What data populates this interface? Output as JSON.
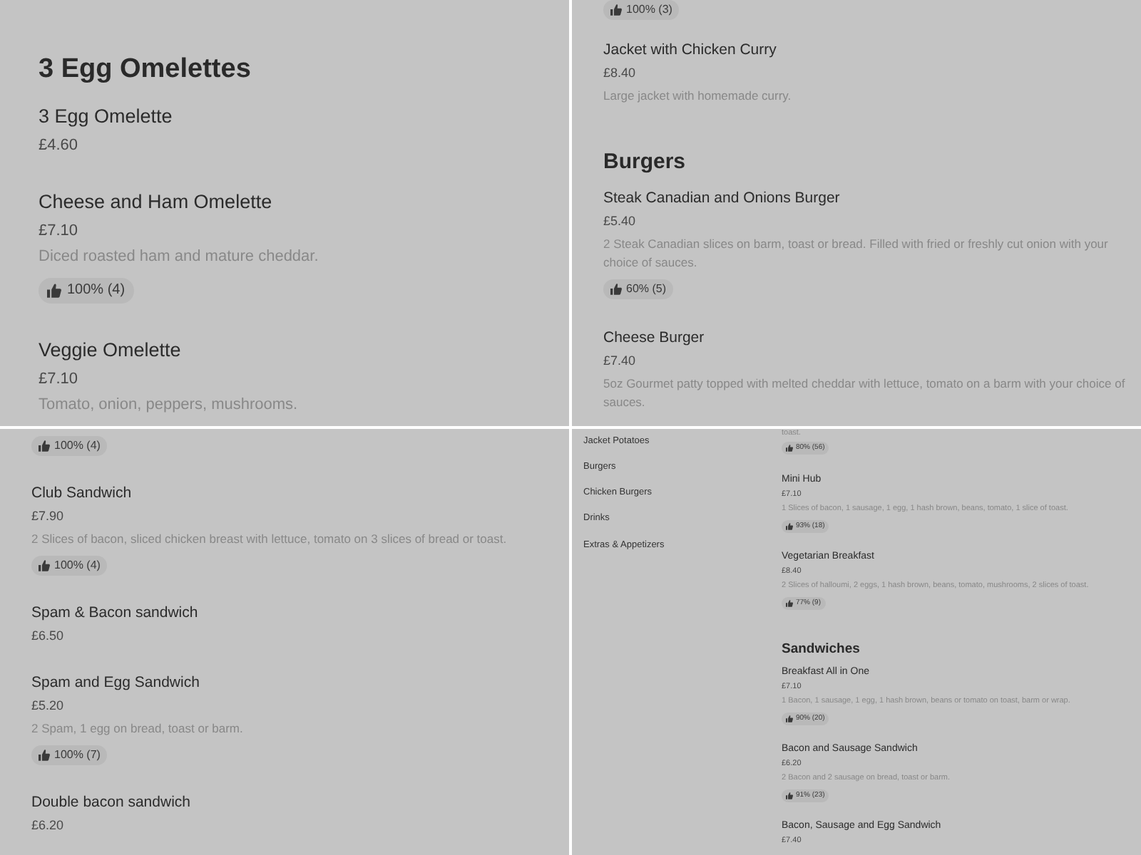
{
  "panels": [
    {
      "entries": [
        {
          "kind": "heading",
          "text": "3 Egg Omelettes"
        },
        {
          "kind": "dish",
          "name": "3 Egg Omelette",
          "price": "£4.60"
        },
        {
          "kind": "dish",
          "name": "Cheese and Ham Omelette",
          "price": "£7.10",
          "description": "Diced roasted ham and mature cheddar.",
          "rating": "100% (4)"
        },
        {
          "kind": "dish",
          "name": "Veggie Omelette",
          "price": "£7.10",
          "description": "Tomato, onion, peppers, mushrooms."
        }
      ]
    },
    {
      "entries": [
        {
          "kind": "rating",
          "rating": "100% (3)"
        },
        {
          "kind": "dish",
          "name": "Jacket with Chicken Curry",
          "price": "£8.40",
          "description": "Large jacket with homemade curry."
        },
        {
          "kind": "heading",
          "text": "Burgers"
        },
        {
          "kind": "dish",
          "name": "Steak Canadian and Onions Burger",
          "price": "£5.40",
          "description": "2 Steak Canadian slices on barm, toast or bread. Filled with fried or freshly cut onion with your choice of sauces.",
          "rating": "60% (5)"
        },
        {
          "kind": "dish",
          "name": "Cheese Burger",
          "price": "£7.40",
          "description": "5oz Gourmet patty topped with melted cheddar with lettuce, tomato on a barm with your choice of sauces."
        }
      ]
    },
    {
      "entries": [
        {
          "kind": "rating",
          "rating": "100% (4)"
        },
        {
          "kind": "dish",
          "name": "Club Sandwich",
          "price": "£7.90",
          "description": "2 Slices of bacon, sliced chicken breast with lettuce, tomato on 3 slices of bread or toast.",
          "rating": "100% (4)"
        },
        {
          "kind": "dish",
          "name": "Spam & Bacon sandwich",
          "price": "£6.50"
        },
        {
          "kind": "dish",
          "name": "Spam and Egg Sandwich",
          "price": "£5.20",
          "description": "2 Spam, 1 egg on bread, toast or barm.",
          "rating": "100% (7)"
        },
        {
          "kind": "dish",
          "name": "Double bacon sandwich",
          "price": "£6.20"
        }
      ]
    },
    {
      "sidebar": {
        "items": [
          "Jacket Potatoes",
          "Burgers",
          "Chicken Burgers",
          "Drinks",
          "Extras & Appetizers"
        ]
      },
      "entries": [
        {
          "kind": "fragment",
          "text": "toast."
        },
        {
          "kind": "rating",
          "rating": "80% (56)"
        },
        {
          "kind": "dish",
          "name": "Mini Hub",
          "price": "£7.10",
          "description": "1 Slices of bacon, 1 sausage, 1 egg, 1 hash brown, beans, tomato, 1 slice of toast.",
          "rating": "93% (18)"
        },
        {
          "kind": "dish",
          "name": "Vegetarian Breakfast",
          "price": "£8.40",
          "description": "2 Slices of halloumi, 2 eggs, 1 hash brown, beans, tomato, mushrooms, 2 slices of toast.",
          "rating": "77% (9)"
        },
        {
          "kind": "heading",
          "text": "Sandwiches"
        },
        {
          "kind": "dish",
          "name": "Breakfast All in One",
          "price": "£7.10",
          "description": "1 Bacon, 1 sausage, 1 egg, 1 hash brown, beans or tomato on toast, barm or wrap.",
          "rating": "90% (20)"
        },
        {
          "kind": "dish",
          "name": "Bacon and Sausage Sandwich",
          "price": "£6.20",
          "description": "2 Bacon and 2 sausage on bread, toast or barm.",
          "rating": "91% (23)"
        },
        {
          "kind": "dish",
          "name": "Bacon, Sausage and Egg Sandwich",
          "price": "£7.40"
        }
      ]
    }
  ]
}
